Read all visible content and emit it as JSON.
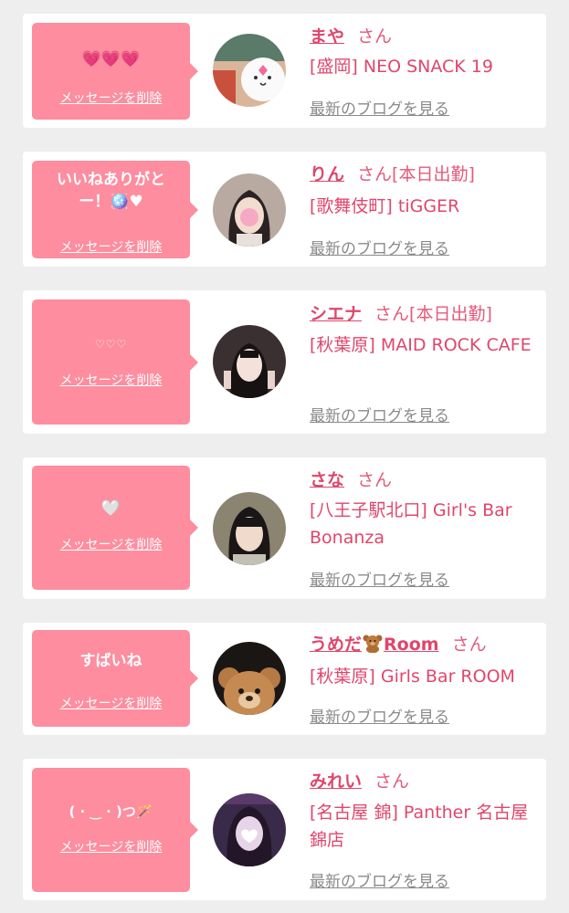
{
  "delete_label": "メッセージを削除",
  "blog_label": "最新のブログを見る",
  "san_label": "さん",
  "colors": {
    "background": "#eeeeee",
    "bubble": "#fd8d9f",
    "name": "#e0466c",
    "link_gray": "#8a8a8a"
  },
  "cards": [
    {
      "message": "💗💗💗",
      "name": "まや",
      "status": "",
      "shop": "[盛岡] NEO SNACK 19"
    },
    {
      "message": "いいねありがと\nー！🪩♥",
      "name": "りん",
      "status": "[本日出勤]",
      "shop": "[歌舞伎町] tiGGER"
    },
    {
      "message": "♡♡♡",
      "name": "シエナ",
      "status": "[本日出勤]",
      "shop": "[秋葉原] MAID ROCK CAFE"
    },
    {
      "message": "🤍",
      "name": "さな",
      "status": "",
      "shop": "[八王子駅北口] Girl's Bar Bonanza"
    },
    {
      "message": "すばいね",
      "name_part1": "うめだ",
      "name_icon": "teddy-bear-icon",
      "name_part2": "Room",
      "status": "",
      "shop": "[秋葉原] Girls Bar ROOM"
    },
    {
      "message": "(  ·  ‿  ·  )つ🪄",
      "name": "みれい",
      "status": "",
      "shop": "[名古屋 錦] Panther 名古屋錦店"
    }
  ]
}
